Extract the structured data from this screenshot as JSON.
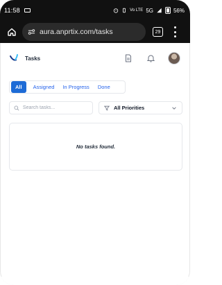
{
  "status_bar": {
    "time": "11:58",
    "network": "Vo LTE",
    "signal": "5G",
    "battery": "56%"
  },
  "browser": {
    "url": "aura.anprtix.com/tasks",
    "tab_count": "29"
  },
  "app": {
    "title": "Tasks"
  },
  "tabs": [
    {
      "label": "All",
      "active": true
    },
    {
      "label": "Assigned",
      "active": false
    },
    {
      "label": "In Progress",
      "active": false
    },
    {
      "label": "Done",
      "active": false
    }
  ],
  "filters": {
    "search_placeholder": "Search tasks...",
    "priority_selected": "All Priorities"
  },
  "tasks": {
    "empty_message": "No tasks found."
  },
  "colors": {
    "accent": "#1d6bd6",
    "tab_text": "#2563eb",
    "browser_bg": "#111111"
  }
}
